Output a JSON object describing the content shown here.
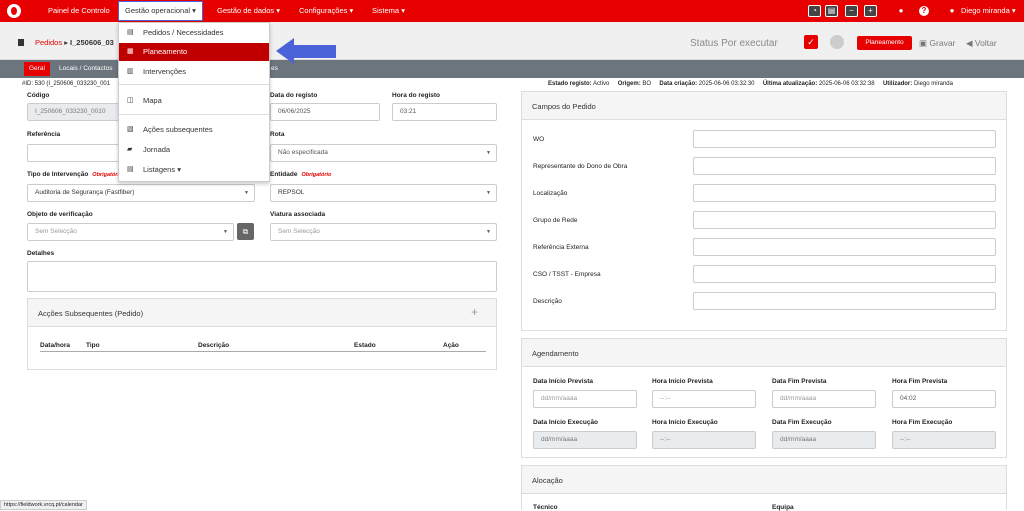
{
  "topnav": {
    "painel": "Painel de Controlo",
    "gestao_op": "Gestão operacional",
    "gestao_dados": "Gestão de dados",
    "config": "Configurações",
    "sistema": "Sistema",
    "user": "Diego miranda"
  },
  "header": {
    "module": "Pedidos",
    "record": "I_250606_03",
    "status": "Status Por executar",
    "planeamento_btn": "Planeamento",
    "gravar": "Gravar",
    "voltar": "Voltar"
  },
  "tabs": {
    "geral": "Geral",
    "locais": "Locais / Contactos",
    "hidden": "es"
  },
  "meta": {
    "id": "#ID: 530 (I_250606_033230_001",
    "estado_label": "Estado registo:",
    "estado": "Activo",
    "origem_label": "Origem:",
    "origem": "BO",
    "criacao_label": "Data criação:",
    "criacao": "2025-06-06 03:32:30",
    "atualizacao_label": "Última atualização:",
    "atualizacao": "2025-06-06 03:32:38",
    "utilizador_label": "Utilizador:",
    "utilizador": "Diego miranda"
  },
  "form": {
    "codigo_label": "Código",
    "codigo": "I_250606_033230_0010",
    "data_registo_label": "Data do registo",
    "data_registo": "06/06/2025",
    "hora_registo_label": "Hora do registo",
    "hora_registo": "03:21",
    "referencia_label": "Referência",
    "rota_label": "Rota",
    "rota": "Não especificada",
    "tipo_label": "Tipo de Intervenção",
    "obrigatorio": "Obrigatório",
    "tipo": "Auditoria de Segurança (Fastfiber)",
    "entidade_label": "Entidade",
    "entidade": "REPSOL",
    "objeto_label": "Objeto de verificação",
    "objeto": "Sem Selecção",
    "viatura_label": "Viatura associada",
    "viatura": "Sem Selecção",
    "detalhes_label": "Detalhes"
  },
  "accoes": {
    "title": "Acções Subsequentes (Pedido)",
    "plus": "+",
    "cols": [
      "Data/hora",
      "Tipo",
      "Descrição",
      "Estado",
      "Ação"
    ]
  },
  "campos": {
    "title": "Campos do Pedido",
    "fields": [
      "WO",
      "Representante do Dono de Obra",
      "Localização",
      "Grupo de Rede",
      "Referência Externa",
      "CSO / TSST - Empresa",
      "Descrição"
    ]
  },
  "agendamento": {
    "title": "Agendamento",
    "row1": [
      "Data Início Prevista",
      "Hora Início Prevista",
      "Data Fim Prevista",
      "Hora Fim Prevista"
    ],
    "row1_vals": [
      "dd/mm/aaaa",
      "--:--",
      "dd/mm/aaaa",
      "04:02"
    ],
    "row2": [
      "Data Início Execução",
      "Hora Início Execução",
      "Data Fim Execução",
      "Hora Fim Execução"
    ],
    "row2_vals": [
      "dd/mm/aaaa",
      "--:--",
      "dd/mm/aaaa",
      "--:--"
    ]
  },
  "alocacao": {
    "title": "Alocação",
    "tecnico": "Técnico",
    "equipa": "Equipa"
  },
  "menu": {
    "items": [
      "Pedidos / Necessidades",
      "Planeamento",
      "Intervenções",
      "Mapa",
      "Ações subsequentes",
      "Jornada",
      "Listagens"
    ]
  },
  "statusbar": "https://fieldwork.vrcq.pt/calendar",
  "colors": {
    "brand": "#e60000",
    "arrow": "#4a63d8"
  }
}
